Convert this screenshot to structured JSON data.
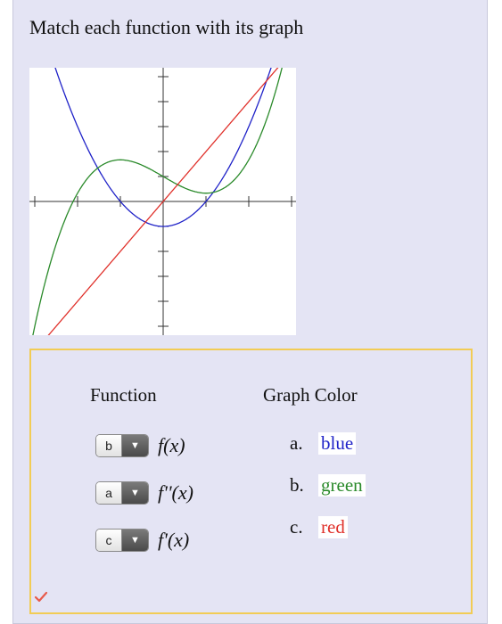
{
  "question": "Match each function with its graph",
  "graph": {
    "curves": [
      {
        "color_name": "blue",
        "color": "#1f22c8",
        "formula": "x^2 - 1"
      },
      {
        "color_name": "green",
        "color": "#2a8a2a",
        "formula": "x^3/3 - x + 1"
      },
      {
        "color_name": "red",
        "color": "#e0302a",
        "formula": "2x"
      }
    ],
    "zoom_icon": "magnifier-icon"
  },
  "headers": {
    "function": "Function",
    "graph_color": "Graph Color"
  },
  "rows": [
    {
      "selected": "b",
      "label": "f(x)"
    },
    {
      "selected": "a",
      "label": "f''(x)"
    },
    {
      "selected": "c",
      "label": "f'(x)"
    }
  ],
  "options": [
    {
      "letter": "a.",
      "name": "blue",
      "color": "#1f22c8"
    },
    {
      "letter": "b.",
      "name": "green",
      "color": "#2a8a2a"
    },
    {
      "letter": "c.",
      "name": "red",
      "color": "#e0302a"
    }
  ],
  "status_icon": "checkmark-icon",
  "status_color": "#e85a4a"
}
